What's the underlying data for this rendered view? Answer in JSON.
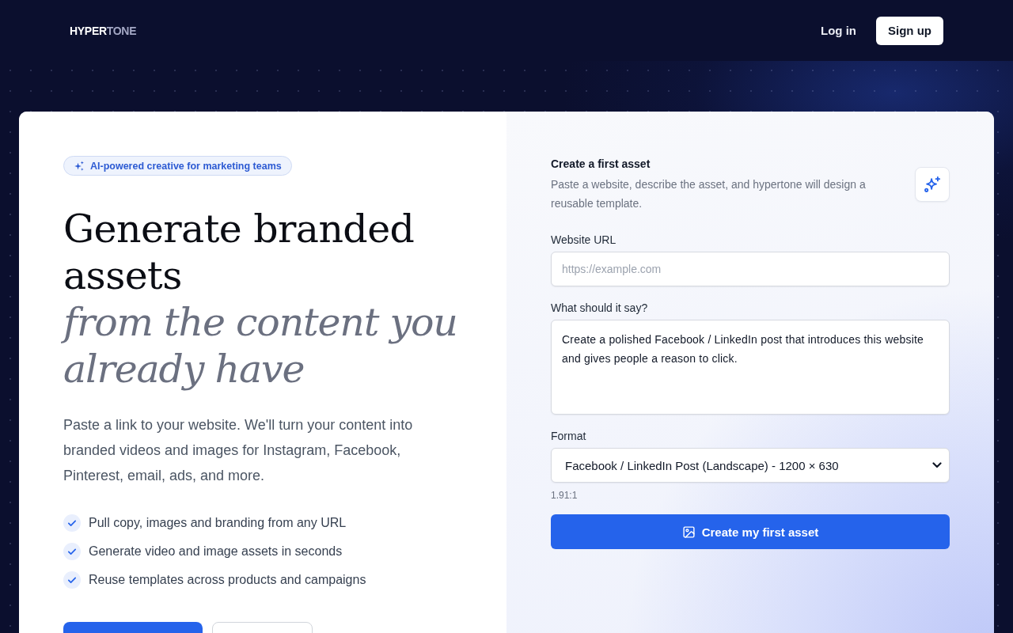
{
  "header": {
    "logo": {
      "bright": "HYPER",
      "muted": "TONE"
    },
    "login": "Log in",
    "signup": "Sign up"
  },
  "hero": {
    "badge": "AI-powered creative for marketing teams",
    "headline": "Generate branded assets *from the content you already have*",
    "description": "Paste a link to your website. We'll turn your content into branded videos and images for Instagram, Facebook, Pinterest, email, ads, and more.",
    "features": [
      "Pull copy, images and branding from any URL",
      "Generate video and image assets in seconds",
      "Reuse templates across products and campaigns"
    ],
    "buttons": [
      {
        "kind": "primary"
      },
      {
        "kind": "outline"
      }
    ]
  },
  "form": {
    "title": "Create a first asset",
    "description": "Paste a website, describe the asset, and hypertone will design a reusable template.",
    "fields": [
      {
        "kind": "input",
        "label": "Website URL",
        "placeholder": "https://example.com"
      },
      {
        "kind": "textarea",
        "label": "What should it say?",
        "value": "Create a polished Facebook / LinkedIn post that introduces this website and gives people a reason to click."
      },
      {
        "kind": "select",
        "label": "Format",
        "value": "Facebook / LinkedIn Post (Landscape) - 1200 × 630",
        "hint": "1.91:1"
      }
    ],
    "submit": "Create my first asset"
  }
}
